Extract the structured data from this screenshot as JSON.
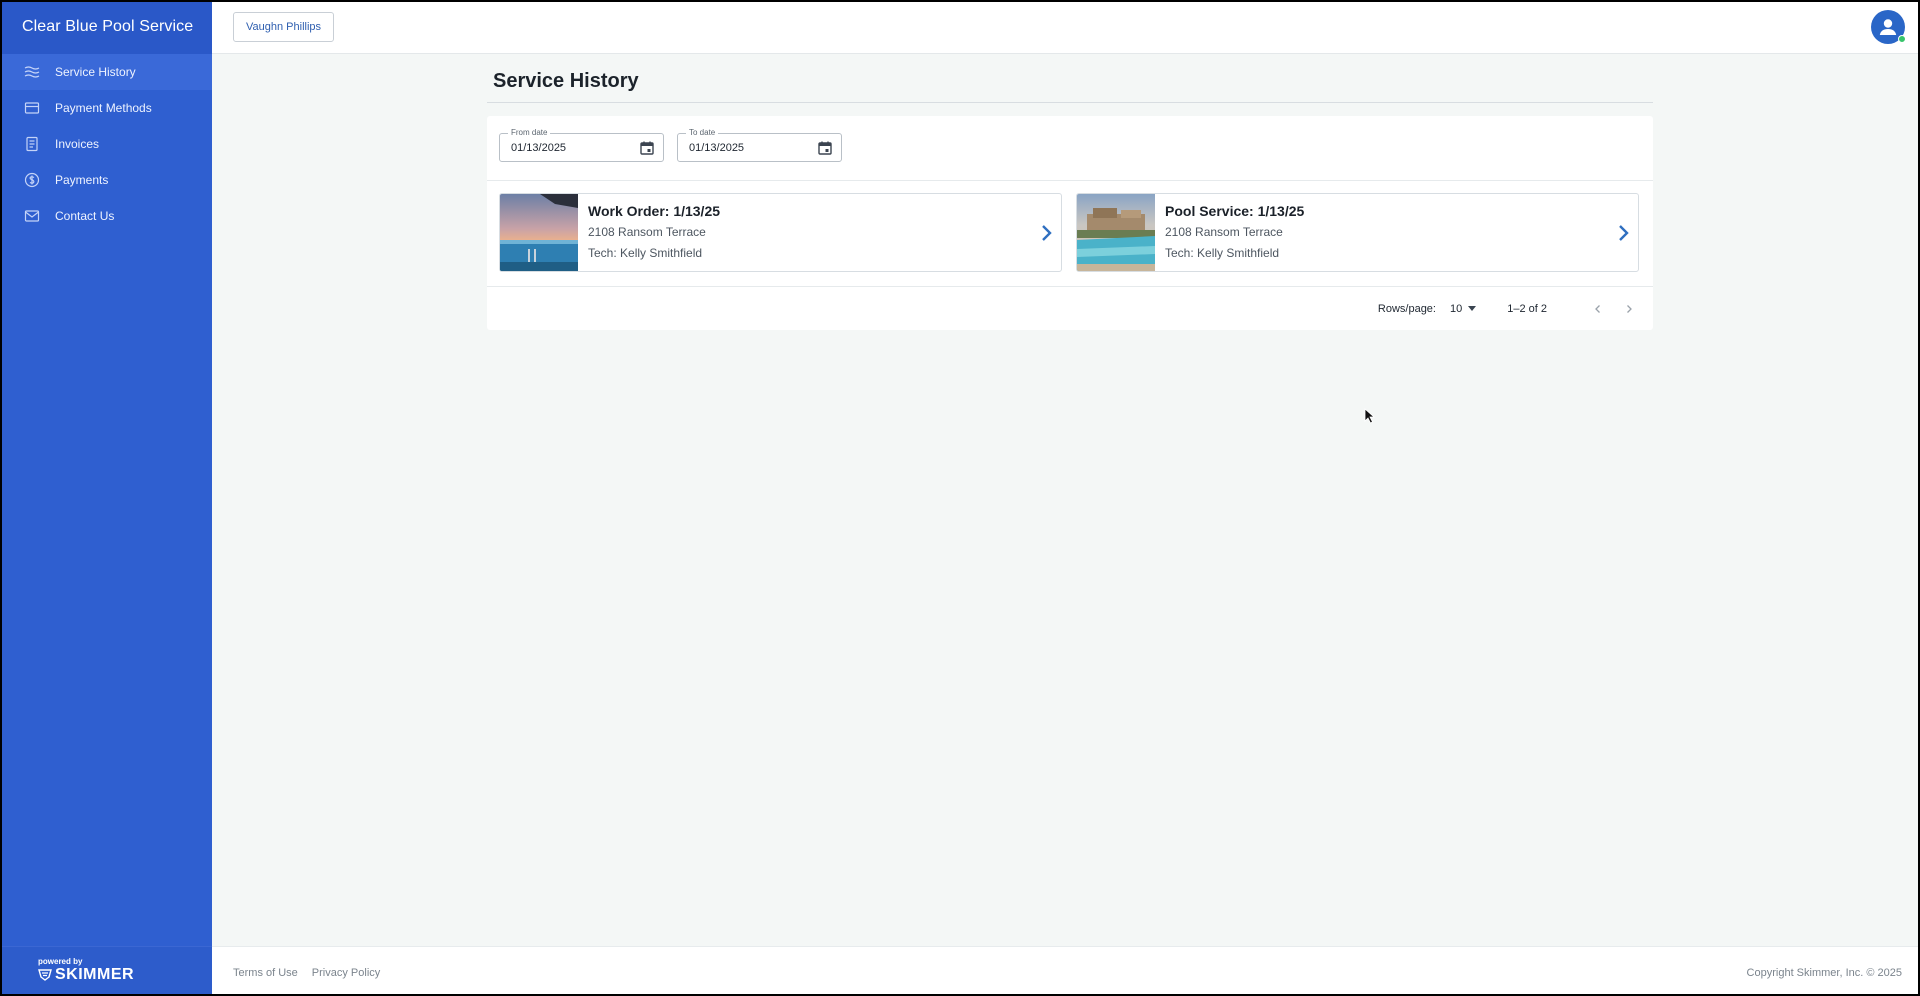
{
  "sidebar": {
    "brand": "Clear Blue Pool Service",
    "items": [
      {
        "label": "Service History",
        "icon": "waves-icon",
        "active": true
      },
      {
        "label": "Payment Methods",
        "icon": "credit-card-icon"
      },
      {
        "label": "Invoices",
        "icon": "document-icon"
      },
      {
        "label": "Payments",
        "icon": "dollar-circle-icon"
      },
      {
        "label": "Contact Us",
        "icon": "mail-icon"
      }
    ],
    "powered_by": "powered by",
    "powered_brand": "SKIMMER"
  },
  "header": {
    "customer_button": "Vaughn Phillips",
    "avatar_icon": "user-avatar-icon"
  },
  "main": {
    "title": "Service History",
    "filters": {
      "from_label": "From date",
      "from_value": "01/13/2025",
      "to_label": "To date",
      "to_value": "01/13/2025"
    },
    "cards": [
      {
        "title": "Work Order: 1/13/25",
        "address": "2108 Ransom Terrace",
        "tech": "Tech: Kelly Smithfield",
        "thumb": "pool-sunset-photo"
      },
      {
        "title": "Pool Service: 1/13/25",
        "address": "2108 Ransom Terrace",
        "tech": "Tech: Kelly Smithfield",
        "thumb": "backyard-pool-photo"
      }
    ],
    "pagination": {
      "rows_label": "Rows/page:",
      "rows_value": "10",
      "range": "1–2 of 2"
    }
  },
  "footer": {
    "terms": "Terms of Use",
    "privacy": "Privacy Policy",
    "copyright": "Copyright Skimmer, Inc. © 2025"
  },
  "colors": {
    "sidebar_bg": "#2f5fd0",
    "accent": "#2f5fb0",
    "page_bg": "#f4f7f6"
  }
}
